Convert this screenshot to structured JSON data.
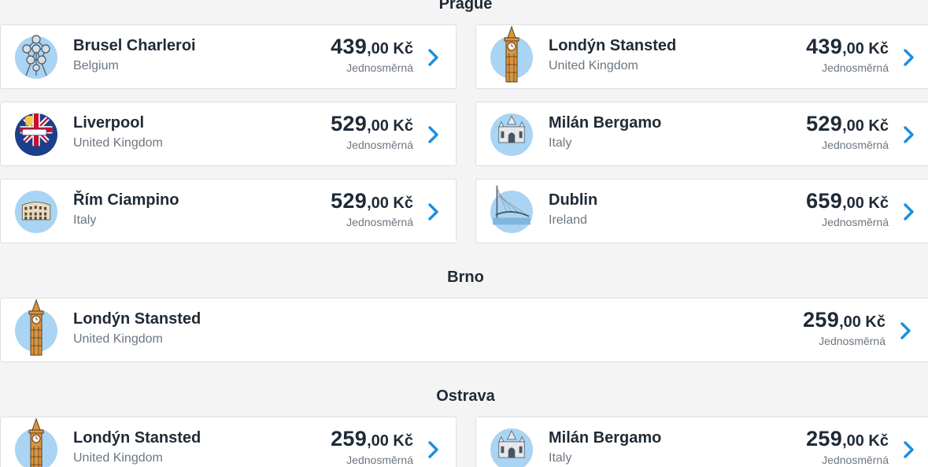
{
  "sections": [
    {
      "title": "Prague",
      "routes": [
        {
          "name": "Brusel Charleroi",
          "country": "Belgium",
          "price_whole": "439",
          "price_dec": ",00",
          "currency": " Kč",
          "fare": "Jednosměrná",
          "icon": "atomium-icon"
        },
        {
          "name": "Londýn Stansted",
          "country": "United Kingdom",
          "price_whole": "439",
          "price_dec": ",00",
          "currency": " Kč",
          "fare": "Jednosměrná",
          "icon": "big-ben-icon"
        },
        {
          "name": "Liverpool",
          "country": "United Kingdom",
          "price_whole": "529",
          "price_dec": ",00",
          "currency": " Kč",
          "fare": "Jednosměrná",
          "icon": "liverpool-icon"
        },
        {
          "name": "Milán Bergamo",
          "country": "Italy",
          "price_whole": "529",
          "price_dec": ",00",
          "currency": " Kč",
          "fare": "Jednosměrná",
          "icon": "milan-cathedral-icon"
        },
        {
          "name": "Řím Ciampino",
          "country": "Italy",
          "price_whole": "529",
          "price_dec": ",00",
          "currency": " Kč",
          "fare": "Jednosměrná",
          "icon": "colosseum-icon"
        },
        {
          "name": "Dublin",
          "country": "Ireland",
          "price_whole": "659",
          "price_dec": ",00",
          "currency": " Kč",
          "fare": "Jednosměrná",
          "icon": "dublin-bridge-icon"
        }
      ]
    },
    {
      "title": "Brno",
      "routes": [
        {
          "name": "Londýn Stansted",
          "country": "United Kingdom",
          "price_whole": "259",
          "price_dec": ",00",
          "currency": " Kč",
          "fare": "Jednosměrná",
          "icon": "big-ben-icon"
        }
      ]
    },
    {
      "title": "Ostrava",
      "routes": [
        {
          "name": "Londýn Stansted",
          "country": "United Kingdom",
          "price_whole": "259",
          "price_dec": ",00",
          "currency": " Kč",
          "fare": "Jednosměrná",
          "icon": "big-ben-icon"
        },
        {
          "name": "Milán Bergamo",
          "country": "Italy",
          "price_whole": "259",
          "price_dec": ",00",
          "currency": " Kč",
          "fare": "Jednosměrná",
          "icon": "milan-cathedral-icon"
        }
      ]
    }
  ],
  "colors": {
    "accent": "#1a8fe0",
    "icon_bg": "#a9d4f3",
    "card_bg": "#ffffff",
    "page_bg": "#f4f4f4"
  }
}
